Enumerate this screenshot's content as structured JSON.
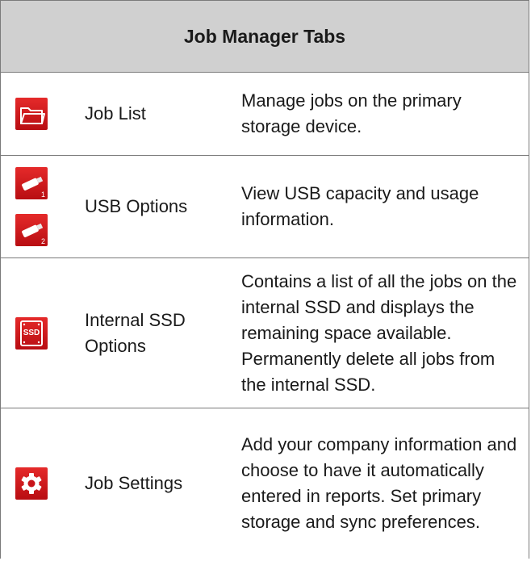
{
  "table": {
    "title": "Job Manager Tabs",
    "rows": [
      {
        "icon": "folder-icon",
        "label": "Job List",
        "description": "Manage jobs on the primary storage device."
      },
      {
        "icon": "usb-drive-icon",
        "badges": [
          "1",
          "2"
        ],
        "label": "USB Options",
        "description": "View USB capacity and usage information."
      },
      {
        "icon": "ssd-icon",
        "icon_text": "SSD",
        "label": "Internal SSD Options",
        "description": "Contains a list of all the jobs on the internal SSD and displays the remaining space available. Permanently delete all jobs from the internal SSD."
      },
      {
        "icon": "gear-icon",
        "label": "Job Settings",
        "description": "Add your company information and choose to have it automatically entered in reports. Set primary storage and sync preferences."
      }
    ]
  },
  "colors": {
    "icon_red": "#d3181e",
    "header_bg": "#d0d0d0",
    "border": "#7a7a7a"
  }
}
